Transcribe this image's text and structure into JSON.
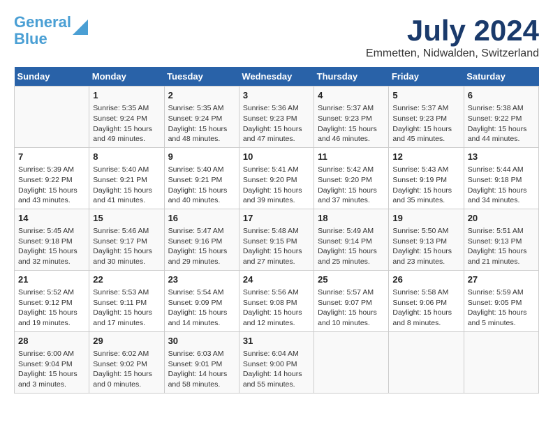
{
  "header": {
    "logo_general": "General",
    "logo_blue": "Blue",
    "title": "July 2024",
    "subtitle": "Emmetten, Nidwalden, Switzerland"
  },
  "days_of_week": [
    "Sunday",
    "Monday",
    "Tuesday",
    "Wednesday",
    "Thursday",
    "Friday",
    "Saturday"
  ],
  "weeks": [
    [
      {
        "day": "",
        "content": ""
      },
      {
        "day": "1",
        "content": "Sunrise: 5:35 AM\nSunset: 9:24 PM\nDaylight: 15 hours\nand 49 minutes."
      },
      {
        "day": "2",
        "content": "Sunrise: 5:35 AM\nSunset: 9:24 PM\nDaylight: 15 hours\nand 48 minutes."
      },
      {
        "day": "3",
        "content": "Sunrise: 5:36 AM\nSunset: 9:23 PM\nDaylight: 15 hours\nand 47 minutes."
      },
      {
        "day": "4",
        "content": "Sunrise: 5:37 AM\nSunset: 9:23 PM\nDaylight: 15 hours\nand 46 minutes."
      },
      {
        "day": "5",
        "content": "Sunrise: 5:37 AM\nSunset: 9:23 PM\nDaylight: 15 hours\nand 45 minutes."
      },
      {
        "day": "6",
        "content": "Sunrise: 5:38 AM\nSunset: 9:22 PM\nDaylight: 15 hours\nand 44 minutes."
      }
    ],
    [
      {
        "day": "7",
        "content": "Sunrise: 5:39 AM\nSunset: 9:22 PM\nDaylight: 15 hours\nand 43 minutes."
      },
      {
        "day": "8",
        "content": "Sunrise: 5:40 AM\nSunset: 9:21 PM\nDaylight: 15 hours\nand 41 minutes."
      },
      {
        "day": "9",
        "content": "Sunrise: 5:40 AM\nSunset: 9:21 PM\nDaylight: 15 hours\nand 40 minutes."
      },
      {
        "day": "10",
        "content": "Sunrise: 5:41 AM\nSunset: 9:20 PM\nDaylight: 15 hours\nand 39 minutes."
      },
      {
        "day": "11",
        "content": "Sunrise: 5:42 AM\nSunset: 9:20 PM\nDaylight: 15 hours\nand 37 minutes."
      },
      {
        "day": "12",
        "content": "Sunrise: 5:43 AM\nSunset: 9:19 PM\nDaylight: 15 hours\nand 35 minutes."
      },
      {
        "day": "13",
        "content": "Sunrise: 5:44 AM\nSunset: 9:18 PM\nDaylight: 15 hours\nand 34 minutes."
      }
    ],
    [
      {
        "day": "14",
        "content": "Sunrise: 5:45 AM\nSunset: 9:18 PM\nDaylight: 15 hours\nand 32 minutes."
      },
      {
        "day": "15",
        "content": "Sunrise: 5:46 AM\nSunset: 9:17 PM\nDaylight: 15 hours\nand 30 minutes."
      },
      {
        "day": "16",
        "content": "Sunrise: 5:47 AM\nSunset: 9:16 PM\nDaylight: 15 hours\nand 29 minutes."
      },
      {
        "day": "17",
        "content": "Sunrise: 5:48 AM\nSunset: 9:15 PM\nDaylight: 15 hours\nand 27 minutes."
      },
      {
        "day": "18",
        "content": "Sunrise: 5:49 AM\nSunset: 9:14 PM\nDaylight: 15 hours\nand 25 minutes."
      },
      {
        "day": "19",
        "content": "Sunrise: 5:50 AM\nSunset: 9:13 PM\nDaylight: 15 hours\nand 23 minutes."
      },
      {
        "day": "20",
        "content": "Sunrise: 5:51 AM\nSunset: 9:13 PM\nDaylight: 15 hours\nand 21 minutes."
      }
    ],
    [
      {
        "day": "21",
        "content": "Sunrise: 5:52 AM\nSunset: 9:12 PM\nDaylight: 15 hours\nand 19 minutes."
      },
      {
        "day": "22",
        "content": "Sunrise: 5:53 AM\nSunset: 9:11 PM\nDaylight: 15 hours\nand 17 minutes."
      },
      {
        "day": "23",
        "content": "Sunrise: 5:54 AM\nSunset: 9:09 PM\nDaylight: 15 hours\nand 14 minutes."
      },
      {
        "day": "24",
        "content": "Sunrise: 5:56 AM\nSunset: 9:08 PM\nDaylight: 15 hours\nand 12 minutes."
      },
      {
        "day": "25",
        "content": "Sunrise: 5:57 AM\nSunset: 9:07 PM\nDaylight: 15 hours\nand 10 minutes."
      },
      {
        "day": "26",
        "content": "Sunrise: 5:58 AM\nSunset: 9:06 PM\nDaylight: 15 hours\nand 8 minutes."
      },
      {
        "day": "27",
        "content": "Sunrise: 5:59 AM\nSunset: 9:05 PM\nDaylight: 15 hours\nand 5 minutes."
      }
    ],
    [
      {
        "day": "28",
        "content": "Sunrise: 6:00 AM\nSunset: 9:04 PM\nDaylight: 15 hours\nand 3 minutes."
      },
      {
        "day": "29",
        "content": "Sunrise: 6:02 AM\nSunset: 9:02 PM\nDaylight: 15 hours\nand 0 minutes."
      },
      {
        "day": "30",
        "content": "Sunrise: 6:03 AM\nSunset: 9:01 PM\nDaylight: 14 hours\nand 58 minutes."
      },
      {
        "day": "31",
        "content": "Sunrise: 6:04 AM\nSunset: 9:00 PM\nDaylight: 14 hours\nand 55 minutes."
      },
      {
        "day": "",
        "content": ""
      },
      {
        "day": "",
        "content": ""
      },
      {
        "day": "",
        "content": ""
      }
    ]
  ]
}
